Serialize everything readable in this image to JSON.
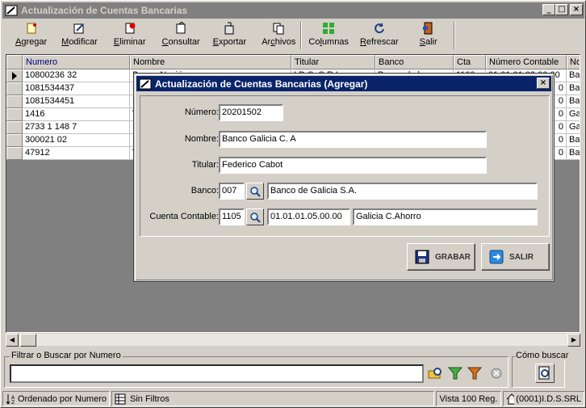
{
  "window": {
    "title": "Actualización de Cuentas Bancarias"
  },
  "toolbar": {
    "items": [
      {
        "label_pre": "",
        "label_u": "A",
        "label_post": "gregar"
      },
      {
        "label_pre": "",
        "label_u": "M",
        "label_post": "odificar"
      },
      {
        "label_pre": "",
        "label_u": "E",
        "label_post": "liminar"
      },
      {
        "label_pre": "",
        "label_u": "C",
        "label_post": "onsultar"
      },
      {
        "label_pre": "",
        "label_u": "E",
        "label_post": "xportar"
      },
      {
        "label_pre": "Ar",
        "label_u": "c",
        "label_post": "hivos"
      },
      {
        "label_pre": "Co",
        "label_u": "l",
        "label_post": "umnas"
      },
      {
        "label_pre": "",
        "label_u": "R",
        "label_post": "efrescar"
      },
      {
        "label_pre": "",
        "label_u": "S",
        "label_post": "alir"
      }
    ]
  },
  "grid": {
    "columns": [
      "Numero",
      "Nombre",
      "Titular",
      "Banco",
      "Cta",
      "Número Contable",
      "No"
    ],
    "rows": [
      [
        "10800236 32",
        "Banco Nación",
        "I.D.S. S.R.L.",
        "Banco de la",
        "1100",
        "01.01.01.03.00.00",
        "Ba"
      ],
      [
        "1081534437",
        "B",
        "",
        "",
        "",
        "0",
        "Ba"
      ],
      [
        "1081534451",
        "B",
        "",
        "",
        "",
        "0",
        "Ba"
      ],
      [
        "1416",
        "V",
        "",
        "",
        "",
        "0",
        "Ga"
      ],
      [
        "2733 1 148 7",
        "B",
        "",
        "",
        "",
        "0",
        "Ga"
      ],
      [
        "300021 02",
        "B",
        "",
        "",
        "",
        "0",
        "Ba"
      ],
      [
        "47912",
        "V",
        "",
        "",
        "",
        "0",
        "Ba"
      ]
    ]
  },
  "filter": {
    "legend": "Filtrar o Buscar por Numero",
    "value": ""
  },
  "como": {
    "legend": "Cómo buscar"
  },
  "status": {
    "order": "Ordenado por Numero",
    "filters": "Sin Filtros",
    "view": "Vista 100 Reg.",
    "company": "(0001)I.D.S.SRL"
  },
  "dialog": {
    "title": "Actualización de Cuentas Bancarias (Agregar)",
    "numero_label": "Número:",
    "numero_value": "20201502",
    "nombre_label": "Nombre:",
    "nombre_value": "Banco Galicia C. A",
    "titular_label": "Titular:",
    "titular_value": "Federico Cabot",
    "banco_label": "Banco:",
    "banco_code": "007",
    "banco_name": "Banco de Galicia S.A.",
    "cuenta_label": "Cuenta Contable:",
    "cuenta_code": "1105",
    "cuenta_number": "01.01.01.05.00.00",
    "cuenta_name": "Galicia C.Ahorro",
    "grabar_label": "GRABAR",
    "salir_label": "SALIR"
  }
}
